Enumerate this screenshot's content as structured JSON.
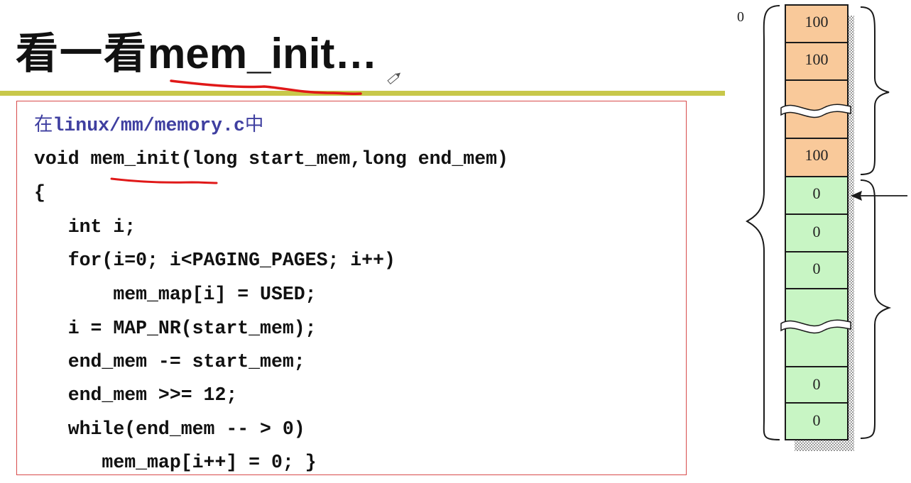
{
  "title": {
    "prefix": "看一看",
    "code": "mem_init…"
  },
  "code": {
    "comment": {
      "prefix": "在",
      "path": "linux/mm/memory.c",
      "suffix": "中"
    },
    "lines": [
      "void mem_init(long start_mem,long end_mem)",
      "{",
      "   int i;",
      "   for(i=0; i<PAGING_PAGES; i++)",
      "       mem_map[i] = USED;",
      "   i = MAP_NR(start_mem);",
      "   end_mem -= start_mem;",
      "   end_mem >>= 12;",
      "   while(end_mem -- > 0)",
      "      mem_map[i++] = 0; }"
    ]
  },
  "memory_map": {
    "base_label": "0",
    "cells": [
      "100",
      "100",
      "",
      "100",
      "0",
      "0",
      "0",
      "",
      "0",
      "0"
    ],
    "colors": {
      "used": "#f9c99a",
      "free": "#c8f5c4",
      "border": "#1a1a1a"
    }
  },
  "annotation_color": "#e01818"
}
